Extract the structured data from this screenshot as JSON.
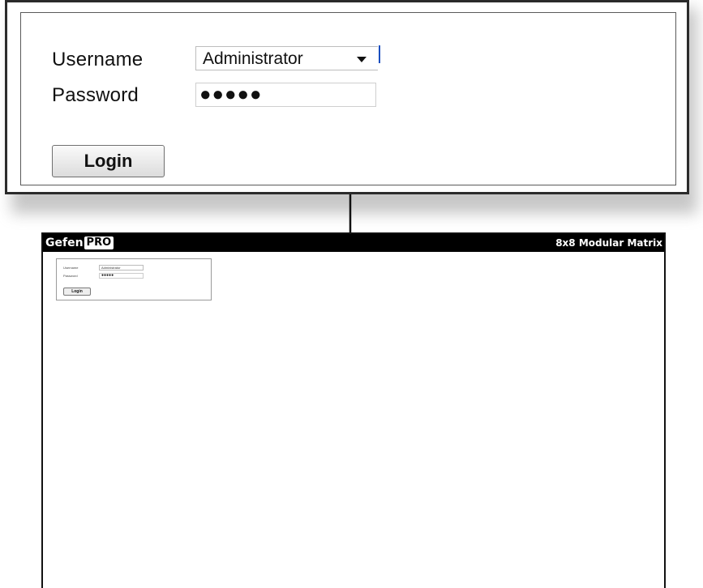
{
  "login_form": {
    "username_label": "Username",
    "username_value": "Administrator",
    "password_label": "Password",
    "password_value": "●●●●●",
    "login_label": "Login"
  },
  "app": {
    "logo_text_gefen": "Gefen",
    "logo_text_pro": "PRO",
    "title": "8x8 Modular Matrix",
    "header_color": "#000000"
  },
  "icons": {
    "dropdown": "chevron-down-icon"
  }
}
